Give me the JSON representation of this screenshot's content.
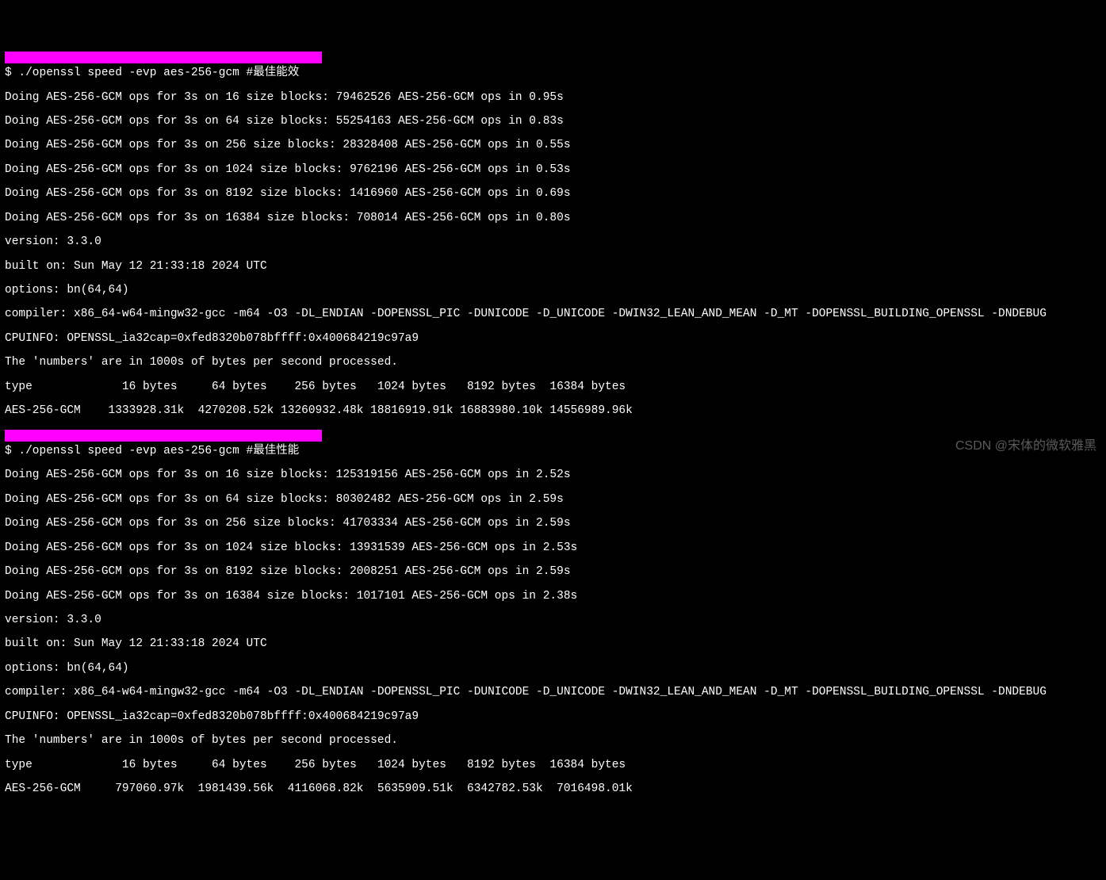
{
  "section1": {
    "prompt": "$ ./openssl speed -evp aes-256-gcm #最佳能效",
    "doing": [
      "Doing AES-256-GCM ops for 3s on 16 size blocks: 79462526 AES-256-GCM ops in 0.95s",
      "Doing AES-256-GCM ops for 3s on 64 size blocks: 55254163 AES-256-GCM ops in 0.83s",
      "Doing AES-256-GCM ops for 3s on 256 size blocks: 28328408 AES-256-GCM ops in 0.55s",
      "Doing AES-256-GCM ops for 3s on 1024 size blocks: 9762196 AES-256-GCM ops in 0.53s",
      "Doing AES-256-GCM ops for 3s on 8192 size blocks: 1416960 AES-256-GCM ops in 0.69s",
      "Doing AES-256-GCM ops for 3s on 16384 size blocks: 708014 AES-256-GCM ops in 0.80s"
    ],
    "version": "version: 3.3.0",
    "built": "built on: Sun May 12 21:33:18 2024 UTC",
    "options": "options: bn(64,64)",
    "compiler": "compiler: x86_64-w64-mingw32-gcc -m64 -O3 -DL_ENDIAN -DOPENSSL_PIC -DUNICODE -D_UNICODE -DWIN32_LEAN_AND_MEAN -D_MT -DOPENSSL_BUILDING_OPENSSL -DNDEBUG",
    "cpuinfo": "CPUINFO: OPENSSL_ia32cap=0xfed8320b078bffff:0x400684219c97a9",
    "legend": "The 'numbers' are in 1000s of bytes per second processed.",
    "header": "type             16 bytes     64 bytes    256 bytes   1024 bytes   8192 bytes  16384 bytes",
    "result": "AES-256-GCM    1333928.31k  4270208.52k 13260932.48k 18816919.91k 16883980.10k 14556989.96k"
  },
  "section2": {
    "prompt": "$ ./openssl speed -evp aes-256-gcm #最佳性能",
    "doing": [
      "Doing AES-256-GCM ops for 3s on 16 size blocks: 125319156 AES-256-GCM ops in 2.52s",
      "Doing AES-256-GCM ops for 3s on 64 size blocks: 80302482 AES-256-GCM ops in 2.59s",
      "Doing AES-256-GCM ops for 3s on 256 size blocks: 41703334 AES-256-GCM ops in 2.59s",
      "Doing AES-256-GCM ops for 3s on 1024 size blocks: 13931539 AES-256-GCM ops in 2.53s",
      "Doing AES-256-GCM ops for 3s on 8192 size blocks: 2008251 AES-256-GCM ops in 2.59s",
      "Doing AES-256-GCM ops for 3s on 16384 size blocks: 1017101 AES-256-GCM ops in 2.38s"
    ],
    "version": "version: 3.3.0",
    "built": "built on: Sun May 12 21:33:18 2024 UTC",
    "options": "options: bn(64,64)",
    "compiler": "compiler: x86_64-w64-mingw32-gcc -m64 -O3 -DL_ENDIAN -DOPENSSL_PIC -DUNICODE -D_UNICODE -DWIN32_LEAN_AND_MEAN -D_MT -DOPENSSL_BUILDING_OPENSSL -DNDEBUG",
    "cpuinfo": "CPUINFO: OPENSSL_ia32cap=0xfed8320b078bffff:0x400684219c97a9",
    "legend": "The 'numbers' are in 1000s of bytes per second processed.",
    "header": "type             16 bytes     64 bytes    256 bytes   1024 bytes   8192 bytes  16384 bytes",
    "result": "AES-256-GCM     797060.97k  1981439.56k  4116068.82k  5635909.51k  6342782.53k  7016498.01k"
  },
  "watermark": "CSDN @宋体的微软雅黑"
}
